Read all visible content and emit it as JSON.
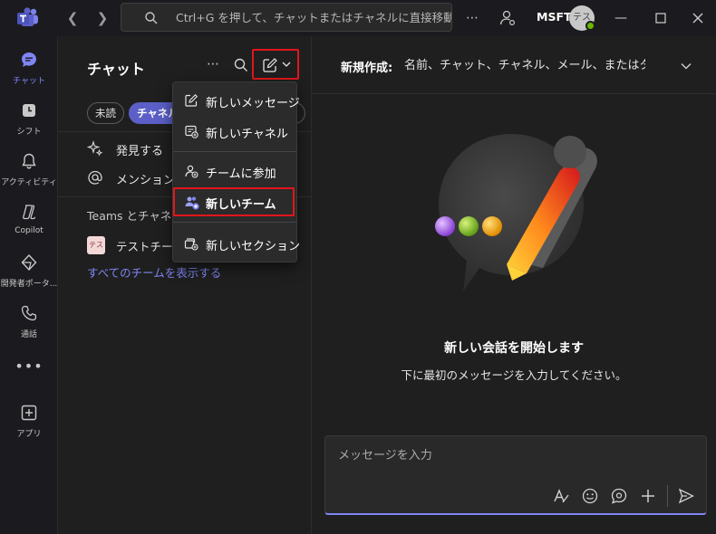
{
  "titlebar": {
    "search_placeholder": "Ctrl+G を押して、チャットまたはチャネルに直接移動する",
    "org": "MSFT",
    "avatar_initials": "テス"
  },
  "rail": {
    "items": [
      {
        "label": "チャット",
        "icon": "chat-icon",
        "active": true
      },
      {
        "label": "シフト",
        "icon": "shifts-icon"
      },
      {
        "label": "アクティビティ",
        "icon": "bell-icon"
      },
      {
        "label": "Copilot",
        "icon": "copilot-icon"
      },
      {
        "label": "開発者ポータ...",
        "icon": "developer-portal-icon"
      },
      {
        "label": "通話",
        "icon": "phone-icon"
      },
      {
        "label": "アプリ",
        "icon": "add-app-icon"
      }
    ],
    "more": "•••"
  },
  "listpane": {
    "title": "チャット",
    "more": "⋯",
    "filters": {
      "unread": "未読",
      "channel": "チャネル"
    },
    "rows": {
      "discover": "発見する",
      "mentions": "メンション"
    },
    "section_label": "Teams とチャネル",
    "team": {
      "avatar": "テス",
      "name": "テストチーム"
    },
    "show_all": "すべてのチームを表示する"
  },
  "menu": {
    "new_message": "新しいメッセージ",
    "new_channel": "新しいチャネル",
    "join_team": "チームに参加",
    "new_team": "新しいチーム",
    "new_section": "新しいセクション"
  },
  "main": {
    "to_label": "新規作成:",
    "to_placeholder": "名前、チャット、チャネル、メール、またはタグを入力",
    "hero_title": "新しい会話を開始します",
    "hero_subtitle": "下に最初のメッセージを入力してください。",
    "compose_placeholder": "メッセージを入力"
  },
  "colors": {
    "accent": "#7f85f5",
    "brand": "#5b5fc7",
    "highlight_border": "#e0161a",
    "status_available": "#6bb700"
  }
}
